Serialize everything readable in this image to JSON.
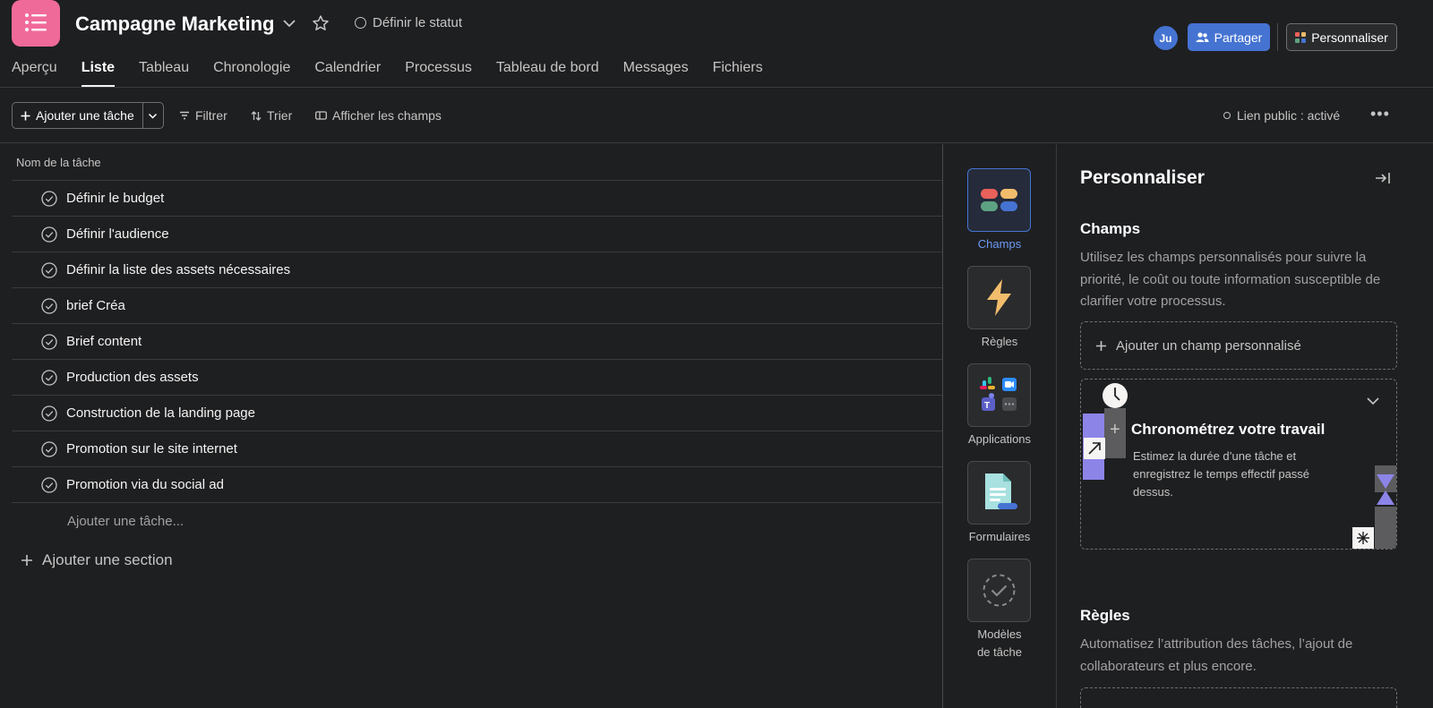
{
  "header": {
    "project_title": "Campagne Marketing",
    "status_label": "Définir le statut",
    "avatar_initials": "Ju",
    "share_label": "Partager",
    "customize_label": "Personnaliser",
    "app_icon_color": "#f06a99",
    "accent_color": "#4573d2"
  },
  "tabs": [
    {
      "label": "Aperçu"
    },
    {
      "label": "Liste"
    },
    {
      "label": "Tableau"
    },
    {
      "label": "Chronologie"
    },
    {
      "label": "Calendrier"
    },
    {
      "label": "Processus"
    },
    {
      "label": "Tableau de bord"
    },
    {
      "label": "Messages"
    },
    {
      "label": "Fichiers"
    }
  ],
  "active_tab": "Liste",
  "toolbar": {
    "add_task_label": "Ajouter une tâche",
    "filter_label": "Filtrer",
    "sort_label": "Trier",
    "fields_label": "Afficher les champs",
    "public_link_label": "Lien public : activé",
    "more_label": "•••"
  },
  "list": {
    "column_header": "Nom de la tâche",
    "tasks": [
      "Définir le budget",
      "Définir l'audience",
      "Définir la liste des assets nécessaires",
      "brief Créa",
      "Brief content",
      "Production des assets",
      "Construction de la landing page",
      "Promotion sur le site internet",
      "Promotion via du social ad"
    ],
    "add_task_placeholder": "Ajouter une tâche...",
    "add_section_label": "Ajouter une section"
  },
  "rail": {
    "items": [
      {
        "label": "Champs",
        "icon": "fields-icon"
      },
      {
        "label": "Règles",
        "icon": "lightning-icon"
      },
      {
        "label": "Applications",
        "icon": "apps-icon"
      },
      {
        "label": "Formulaires",
        "icon": "form-icon"
      },
      {
        "label_line1": "Modèles",
        "label_line2": "de tâche",
        "icon": "task-template-icon"
      }
    ]
  },
  "panel": {
    "title": "Personnaliser",
    "fields_title": "Champs",
    "fields_desc": "Utilisez les champs personnalisés pour suivre la priorité, le coût ou toute information susceptible de clarifier votre processus.",
    "add_field_label": "Ajouter un champ personnalisé",
    "timer_title": "Chronométrez votre travail",
    "timer_desc": "Estimez la durée d’une tâche et enregistrez le temps effectif passé dessus.",
    "rules_title": "Règles",
    "rules_desc": "Automatisez l’attribution des tâches, l’ajout de collaborateurs et plus encore."
  }
}
